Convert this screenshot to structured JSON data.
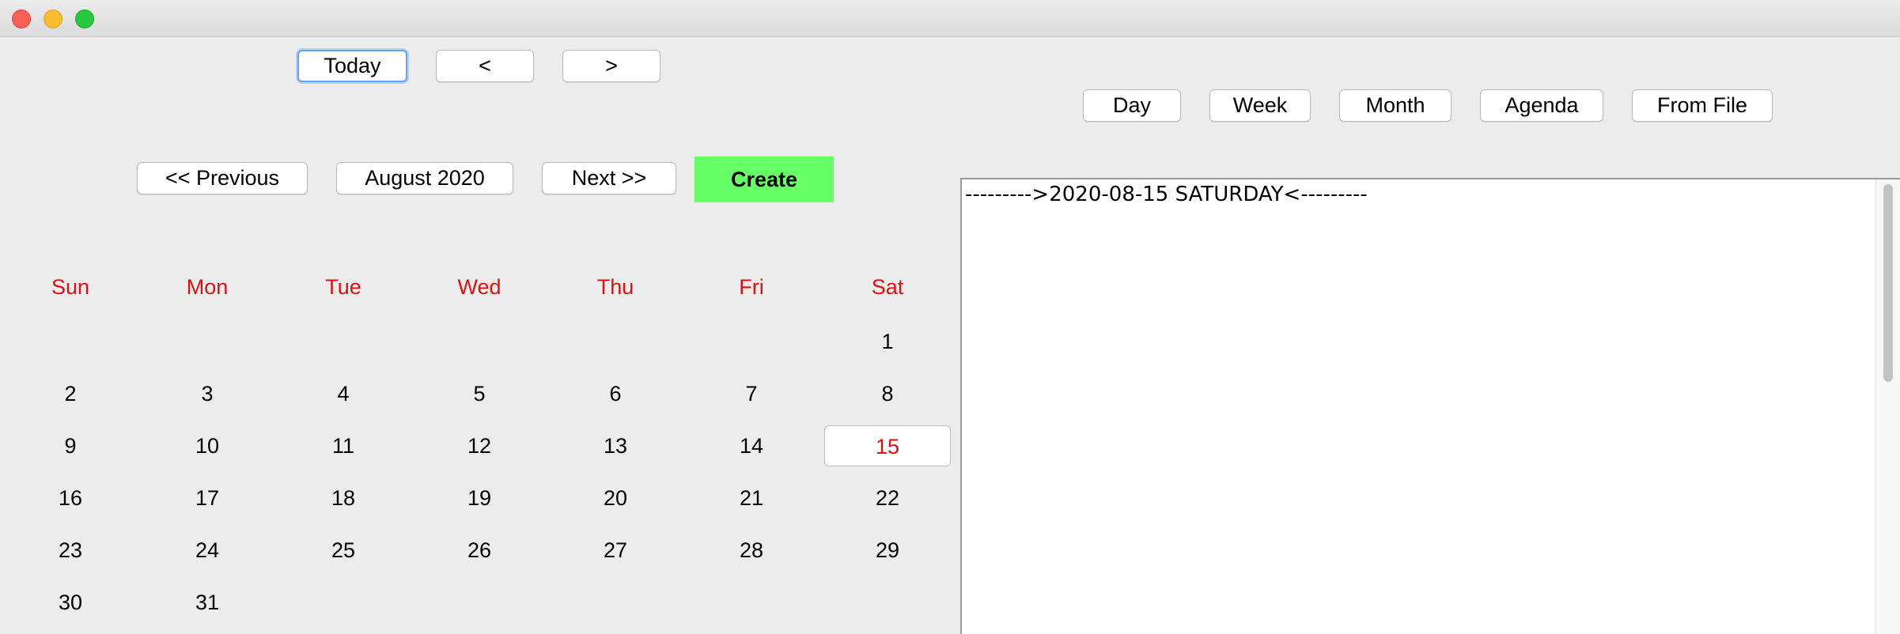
{
  "toolbar": {
    "today": "Today",
    "prev": "<",
    "next": ">"
  },
  "views": {
    "day": "Day",
    "week": "Week",
    "month": "Month",
    "agenda": "Agenda",
    "from_file": "From File"
  },
  "month_nav": {
    "previous": "<< Previous",
    "month_label": "August 2020",
    "next": "Next >>",
    "create": "Create"
  },
  "calendar": {
    "weekdays": [
      "Sun",
      "Mon",
      "Tue",
      "Wed",
      "Thu",
      "Fri",
      "Sat"
    ],
    "weeks": [
      [
        "",
        "",
        "",
        "",
        "",
        "",
        "1"
      ],
      [
        "2",
        "3",
        "4",
        "5",
        "6",
        "7",
        "8"
      ],
      [
        "9",
        "10",
        "11",
        "12",
        "13",
        "14",
        "15"
      ],
      [
        "16",
        "17",
        "18",
        "19",
        "20",
        "21",
        "22"
      ],
      [
        "23",
        "24",
        "25",
        "26",
        "27",
        "28",
        "29"
      ],
      [
        "30",
        "31",
        "",
        "",
        "",
        "",
        ""
      ]
    ],
    "selected_day": "15"
  },
  "agenda": {
    "text": "--------->2020-08-15 SATURDAY<---------"
  },
  "colors": {
    "accent_red": "#e01010",
    "create_green": "#66ff66",
    "focus_blue": "#6aa0e8"
  }
}
